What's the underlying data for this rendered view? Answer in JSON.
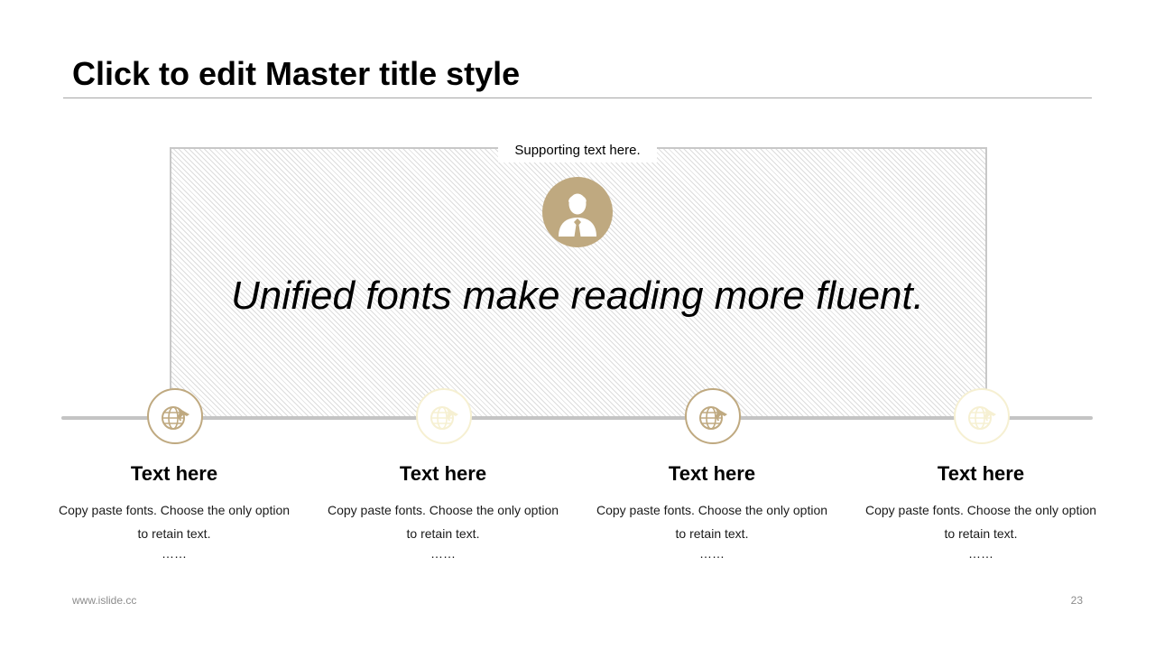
{
  "slide": {
    "title": "Click to edit Master title style",
    "supporting_text": "Supporting text here.",
    "quote": "Unified fonts make reading more fluent.",
    "footer_url": "www.islide.cc",
    "page_number": "23"
  },
  "icons": {
    "center": "businessman-avatar-icon",
    "node": "globe-airplane-icon"
  },
  "colors": {
    "accent": "#bfa980",
    "accent_faded": "#f6f0d2",
    "timeline": "#c4c4c4",
    "title_rule": "#a6a6a6",
    "footer_text": "#8c8c8c"
  },
  "columns": [
    {
      "heading": "Text here",
      "body": "Copy paste fonts. Choose the only option to retain text.",
      "ellipsis": "……",
      "icon_state": "active"
    },
    {
      "heading": "Text here",
      "body": "Copy paste fonts. Choose the only option to retain text.",
      "ellipsis": "……",
      "icon_state": "faded"
    },
    {
      "heading": "Text here",
      "body": "Copy paste fonts. Choose the only option to retain text.",
      "ellipsis": "……",
      "icon_state": "active"
    },
    {
      "heading": "Text here",
      "body": "Copy paste fonts. Choose the only option to retain text.",
      "ellipsis": "……",
      "icon_state": "faded"
    }
  ]
}
